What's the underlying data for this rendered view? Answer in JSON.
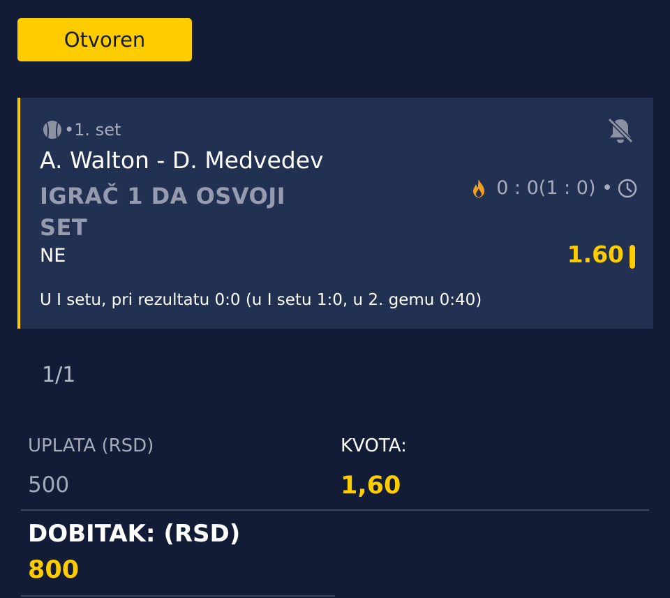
{
  "status": {
    "label": "Otvoren"
  },
  "ticket": {
    "sport_icon": "tennis-ball-icon",
    "period": "•1. set",
    "notification_icon": "bell-off-icon",
    "match": "A. Walton - D. Medvedev",
    "market": "IGRAČ 1 DA OSVOJI SET",
    "live_icon": "flame-icon",
    "score": "0 : 0(1 : 0) •",
    "time_icon": "clock-icon",
    "pick": "NE",
    "odd": "1.60",
    "note": "U I setu, pri rezultatu 0:0 (u I setu 1:0, u 2. gemu 0:40)"
  },
  "pager": "1/1",
  "stake": {
    "label": "UPLATA (RSD)",
    "value": "500"
  },
  "total_odds": {
    "label": "KVOTA:",
    "value": "1,60"
  },
  "payout": {
    "label": "DOBITAK: (RSD)",
    "value": "800"
  },
  "colors": {
    "background": "#121c36",
    "card": "#223152",
    "accent": "#ffcc00",
    "muted": "#a6abb9"
  }
}
